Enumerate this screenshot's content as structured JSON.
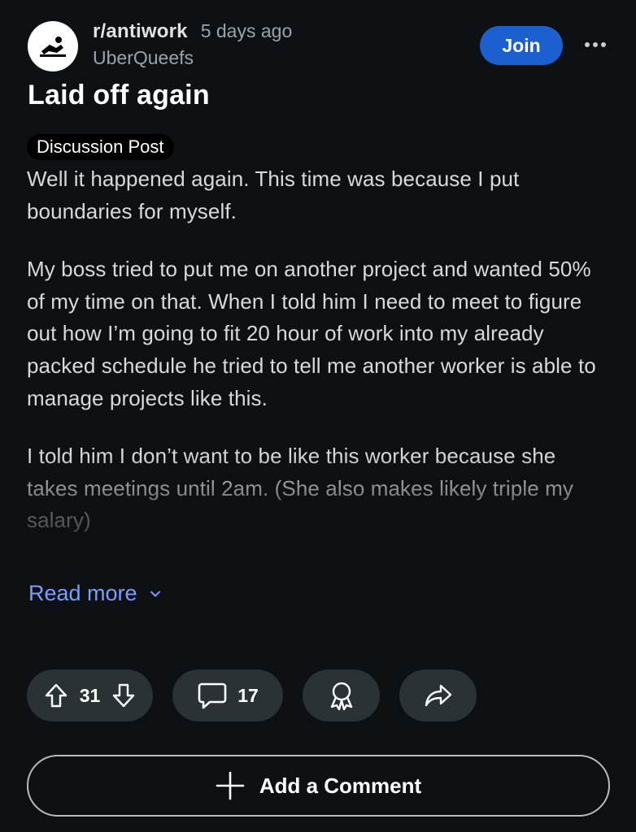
{
  "post": {
    "subreddit": "r/antiwork",
    "time_ago": "5 days ago",
    "author": "UberQueefs",
    "title": "Laid off again",
    "flair": "Discussion Post",
    "paragraphs": [
      "Well it happened again. This time was because I put boundaries for myself.",
      "My boss tried to put me on another project and wanted 50% of my time on that. When I told him I need to meet to figure out how I’m going to fit 20 hour of work into my already packed schedule he tried to tell me another worker is able to manage projects like this.",
      "I told him I don’t want to be like this worker because she takes meetings until 2am. (She also makes likely triple my salary)"
    ],
    "read_more_label": "Read more"
  },
  "header": {
    "join_label": "Join",
    "more_icon": "more-horizontal-icon",
    "avatar_icon": "subreddit-avatar-icon"
  },
  "actions": {
    "upvotes": "31",
    "comments": "17",
    "upvote_icon": "upvote-arrow-icon",
    "downvote_icon": "downvote-arrow-icon",
    "comment_icon": "comment-bubble-icon",
    "award_icon": "award-ribbon-icon",
    "share_icon": "share-arrow-icon"
  },
  "comment_bar": {
    "label": "Add a Comment",
    "icon": "plus-icon"
  },
  "colors": {
    "background": "#0e1113",
    "join_button": "#1c5fd1",
    "pill": "#2a3236",
    "link": "#7c9dff",
    "body_text": "#d7dadc",
    "muted_text": "#9ba3a8"
  }
}
